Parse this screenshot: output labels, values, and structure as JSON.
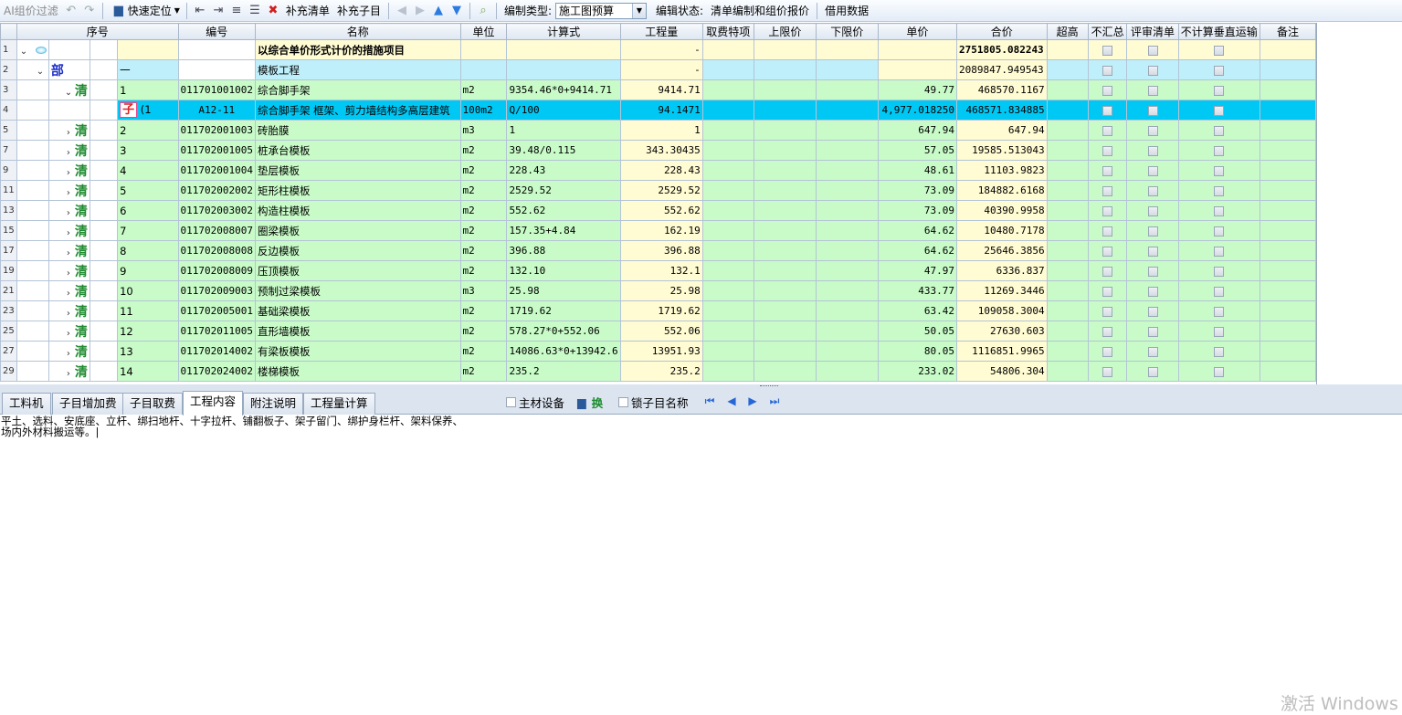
{
  "toolbar": {
    "ai_filter": "AI组价过滤",
    "quick_locate": "快速定位",
    "supplement_list": "补充清单",
    "supplement_sub": "补充子目",
    "compile_type_label": "编制类型:",
    "compile_type_value": "施工图预算",
    "edit_status_label": "编辑状态:",
    "edit_status_value": "清单编制和组价报价",
    "borrow_data": "借用数据"
  },
  "columns": [
    "序号",
    "编号",
    "名称",
    "单位",
    "计算式",
    "工程量",
    "取费特项",
    "上限价",
    "下限价",
    "单价",
    "合价",
    "超高",
    "不汇总",
    "评审清单",
    "不计算垂直运输",
    "备注"
  ],
  "rows": [
    {
      "rn": "1",
      "type": "top",
      "seq": "",
      "code": "",
      "name": "以综合单价形式计价的措施项目",
      "unit": "",
      "formula": "",
      "qty": "-",
      "price": "",
      "total": "2751805.082243"
    },
    {
      "rn": "2",
      "type": "fen",
      "tag": "部",
      "seq": "一",
      "code": "",
      "name": "模板工程",
      "unit": "",
      "formula": "",
      "qty": "-",
      "price": "",
      "total": "2089847.949543"
    },
    {
      "rn": "3",
      "type": "qing",
      "tag": "清",
      "seq": "1",
      "code": "011701001002",
      "name": "综合脚手架",
      "unit": "m2",
      "formula": "9354.46*0+9414.71",
      "qty": "9414.71",
      "price": "49.77",
      "total": "468570.1167"
    },
    {
      "rn": "4",
      "type": "zi",
      "tag": "子",
      "seq": "(1",
      "code": "A12-11",
      "name": "综合脚手架 框架、剪力墙结构多高层建筑",
      "unit": "100m2",
      "formula": "Q/100",
      "qty": "94.1471",
      "price": "4,977.018250",
      "total": "468571.834885"
    },
    {
      "rn": "5",
      "type": "qing",
      "tag": "清",
      "seq": "2",
      "code": "011702001003",
      "name": "砖胎膜",
      "unit": "m3",
      "formula": "1",
      "qty": "1",
      "price": "647.94",
      "total": "647.94"
    },
    {
      "rn": "7",
      "type": "qing",
      "tag": "清",
      "seq": "3",
      "code": "011702001005",
      "name": "桩承台模板",
      "unit": "m2",
      "formula": "39.48/0.115",
      "qty": "343.30435",
      "price": "57.05",
      "total": "19585.513043"
    },
    {
      "rn": "9",
      "type": "qing",
      "tag": "清",
      "seq": "4",
      "code": "011702001004",
      "name": "垫层模板",
      "unit": "m2",
      "formula": "228.43",
      "qty": "228.43",
      "price": "48.61",
      "total": "11103.9823"
    },
    {
      "rn": "11",
      "type": "qing",
      "tag": "清",
      "seq": "5",
      "code": "011702002002",
      "name": "矩形柱模板",
      "unit": "m2",
      "formula": "2529.52",
      "qty": "2529.52",
      "price": "73.09",
      "total": "184882.6168"
    },
    {
      "rn": "13",
      "type": "qing",
      "tag": "清",
      "seq": "6",
      "code": "011702003002",
      "name": "构造柱模板",
      "unit": "m2",
      "formula": "552.62",
      "qty": "552.62",
      "price": "73.09",
      "total": "40390.9958"
    },
    {
      "rn": "15",
      "type": "qing",
      "tag": "清",
      "seq": "7",
      "code": "011702008007",
      "name": "圈梁模板",
      "unit": "m2",
      "formula": "157.35+4.84",
      "qty": "162.19",
      "price": "64.62",
      "total": "10480.7178"
    },
    {
      "rn": "17",
      "type": "qing",
      "tag": "清",
      "seq": "8",
      "code": "011702008008",
      "name": "反边模板",
      "unit": "m2",
      "formula": "396.88",
      "qty": "396.88",
      "price": "64.62",
      "total": "25646.3856"
    },
    {
      "rn": "19",
      "type": "qing",
      "tag": "清",
      "seq": "9",
      "code": "011702008009",
      "name": "压顶模板",
      "unit": "m2",
      "formula": "132.10",
      "qty": "132.1",
      "price": "47.97",
      "total": "6336.837"
    },
    {
      "rn": "21",
      "type": "qing",
      "tag": "清",
      "seq": "10",
      "code": "011702009003",
      "name": "预制过梁模板",
      "unit": "m3",
      "formula": "25.98",
      "qty": "25.98",
      "price": "433.77",
      "total": "11269.3446"
    },
    {
      "rn": "23",
      "type": "qing",
      "tag": "清",
      "seq": "11",
      "code": "011702005001",
      "name": "基础梁模板",
      "unit": "m2",
      "formula": "1719.62",
      "qty": "1719.62",
      "price": "63.42",
      "total": "109058.3004"
    },
    {
      "rn": "25",
      "type": "qing",
      "tag": "清",
      "seq": "12",
      "code": "011702011005",
      "name": "直形墙模板",
      "unit": "m2",
      "formula": "578.27*0+552.06",
      "qty": "552.06",
      "price": "50.05",
      "total": "27630.603"
    },
    {
      "rn": "27",
      "type": "qing",
      "tag": "清",
      "seq": "13",
      "code": "011702014002",
      "name": "有梁板模板",
      "unit": "m2",
      "formula": "14086.63*0+13942.6",
      "qty": "13951.93",
      "price": "80.05",
      "total": "1116851.9965"
    },
    {
      "rn": "29",
      "type": "qing",
      "tag": "清",
      "seq": "14",
      "code": "011702024002",
      "name": "楼梯模板",
      "unit": "m2",
      "formula": "235.2",
      "qty": "235.2",
      "price": "233.02",
      "total": "54806.304"
    }
  ],
  "bottom_tabs": [
    "工料机",
    "子目增加费",
    "子目取费",
    "工程内容",
    "附注说明",
    "工程量计算"
  ],
  "active_tab": "工程内容",
  "options": {
    "main_material": "主材设备",
    "swap": "换",
    "lock_name": "锁子目名称"
  },
  "work_content": {
    "line1": "平土、选料、安底座、立杆、绑扫地杆、十字拉杆、铺翻板子、架子留门、绑护身栏杆、架料保养、",
    "line2": "场内外材料搬运等。|"
  },
  "watermark": "激活 Windows"
}
